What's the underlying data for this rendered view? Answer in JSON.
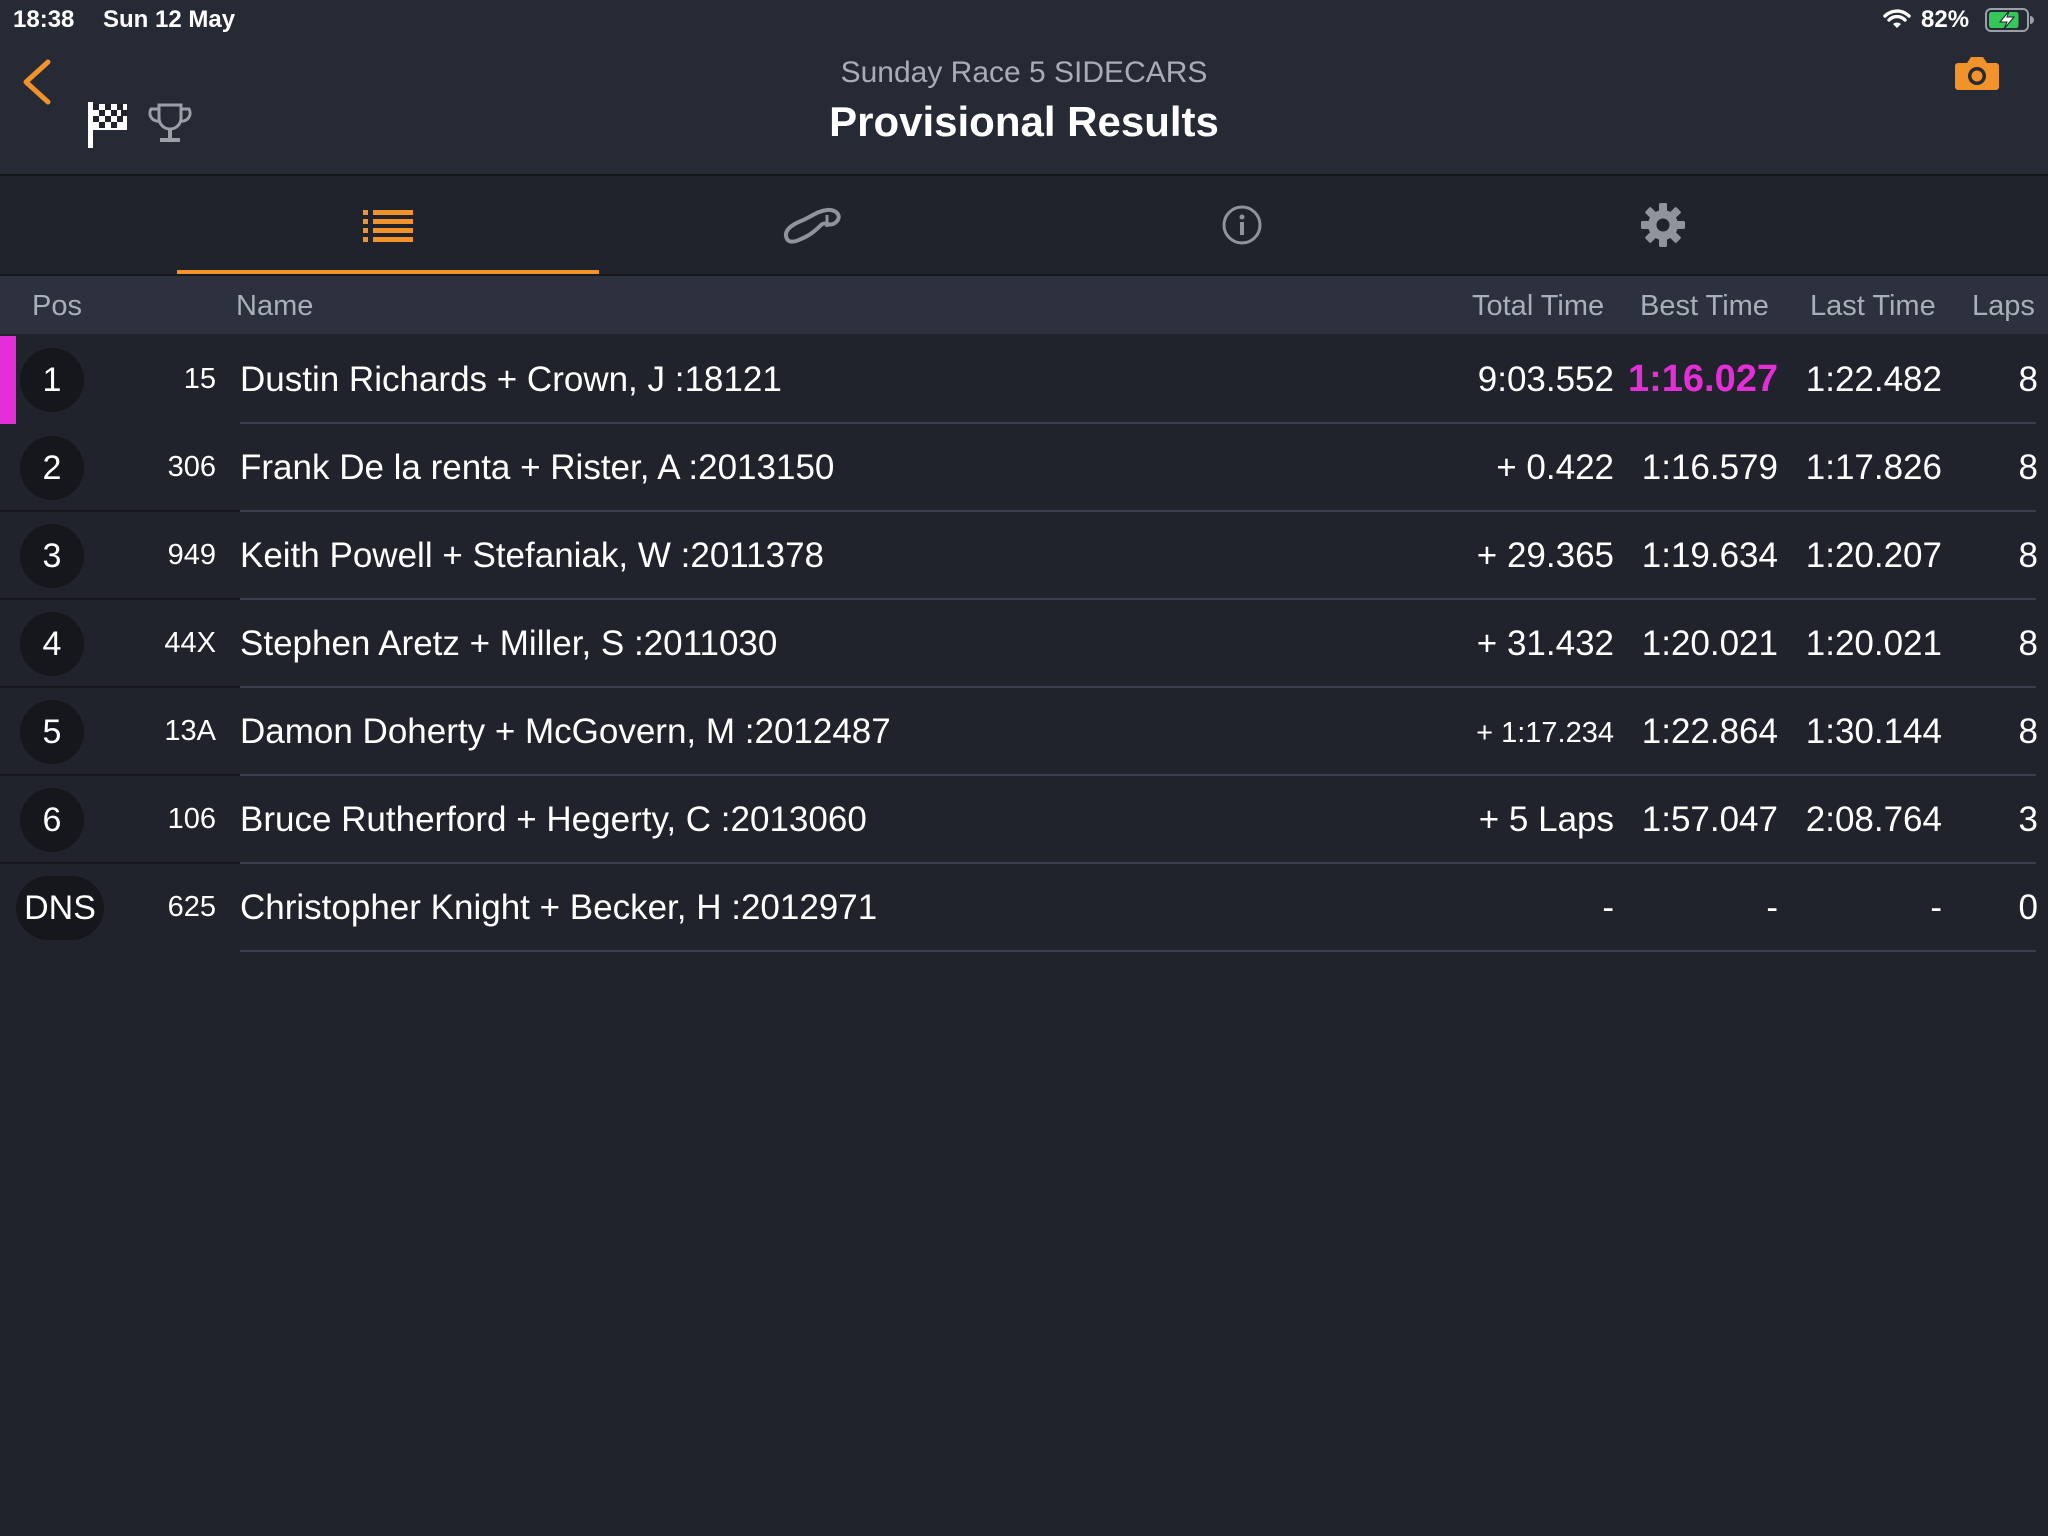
{
  "status_bar": {
    "time": "18:38",
    "date": "Sun 12 May",
    "battery_percent": "82%",
    "battery_level": 0.82,
    "icons": [
      "wifi-icon",
      "battery-charging-icon"
    ]
  },
  "header": {
    "subtitle": "Sunday Race 5 SIDECARS",
    "title": "Provisional Results",
    "icons": [
      "back-chevron-icon",
      "checkered-flag-icon",
      "trophy-icon",
      "camera-icon"
    ]
  },
  "tabs": [
    {
      "icon": "list-icon",
      "active": true
    },
    {
      "icon": "track-icon",
      "active": false
    },
    {
      "icon": "info-icon",
      "active": false
    },
    {
      "icon": "gear-icon",
      "active": false
    }
  ],
  "columns": {
    "pos": "Pos",
    "name": "Name",
    "total_time": "Total Time",
    "best_time": "Best Time",
    "last_time": "Last Time",
    "laps": "Laps"
  },
  "results": [
    {
      "pos": "1",
      "number": "15",
      "name": "Dustin Richards + Crown, J :18121",
      "total": "9:03.552",
      "best": "1:16.027",
      "last": "1:22.482",
      "laps": "8"
    },
    {
      "pos": "2",
      "number": "306",
      "name": "Frank De la renta + Rister, A :2013150",
      "total": "+ 0.422",
      "best": "1:16.579",
      "last": "1:17.826",
      "laps": "8"
    },
    {
      "pos": "3",
      "number": "949",
      "name": "Keith Powell + Stefaniak, W :2011378",
      "total": "+ 29.365",
      "best": "1:19.634",
      "last": "1:20.207",
      "laps": "8"
    },
    {
      "pos": "4",
      "number": "44X",
      "name": "Stephen Aretz + Miller, S :2011030",
      "total": "+ 31.432",
      "best": "1:20.021",
      "last": "1:20.021",
      "laps": "8"
    },
    {
      "pos": "5",
      "number": "13A",
      "name": "Damon Doherty + McGovern, M :2012487",
      "total": "+ 1:17.234",
      "best": "1:22.864",
      "last": "1:30.144",
      "laps": "8"
    },
    {
      "pos": "6",
      "number": "106",
      "name": "Bruce Rutherford + Hegerty, C :2013060",
      "total": "+ 5 Laps",
      "best": "1:57.047",
      "last": "2:08.764",
      "laps": "3"
    },
    {
      "pos": "DNS",
      "number": "625",
      "name": "Christopher Knight + Becker, H :2012971",
      "total": "-",
      "best": "-",
      "last": "-",
      "laps": "0"
    }
  ],
  "colors": {
    "accent": "#f2922a",
    "fastest_lap": "#e62ed8",
    "background": "#20232b",
    "header_bg": "#262a34"
  }
}
